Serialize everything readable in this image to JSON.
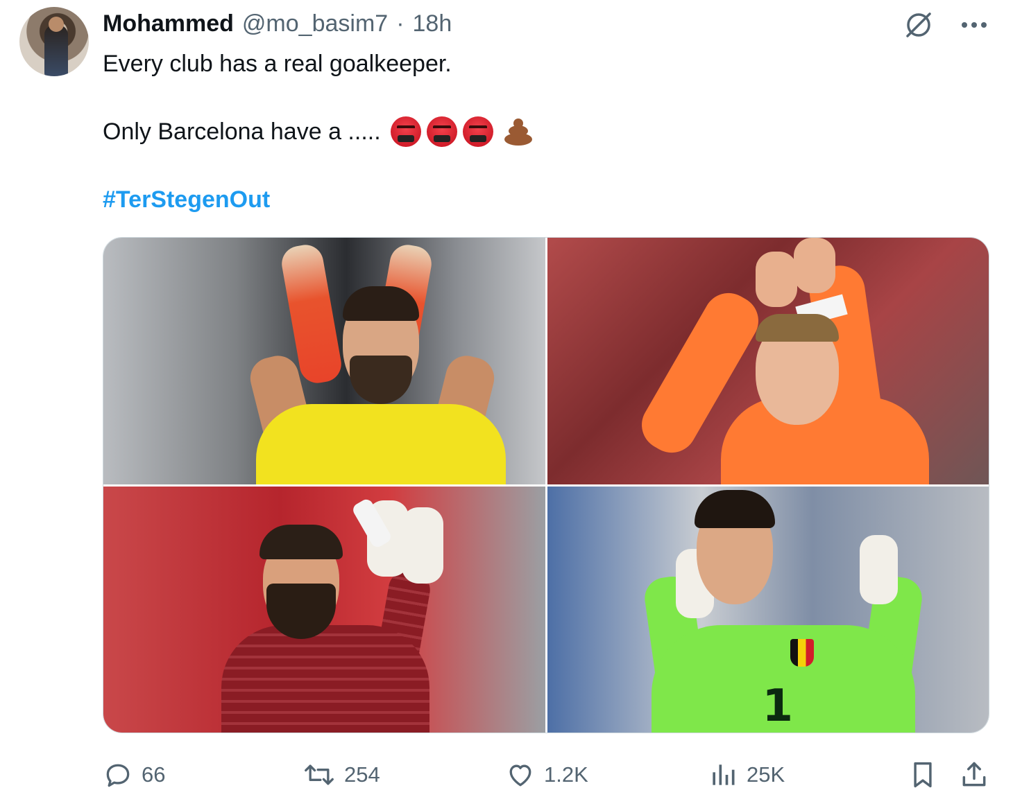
{
  "author": {
    "display_name": "Mohammed",
    "handle": "@mo_basim7",
    "separator": "·",
    "time": "18h"
  },
  "tweet": {
    "line1": "Every club has a real goalkeeper.",
    "line2": "Only Barcelona have a .....",
    "emojis": [
      "face-with-symbols-on-mouth",
      "face-with-symbols-on-mouth",
      "face-with-symbols-on-mouth",
      "pile-of-poo"
    ],
    "hashtag": "#TerStegenOut"
  },
  "media": {
    "photos": [
      {
        "name": "keeper-yellow-kit",
        "kit_color": "#f2e21f"
      },
      {
        "name": "keeper-orange-kit",
        "kit_color": "#ff7a33"
      },
      {
        "name": "keeper-red-kit",
        "kit_color": "#8a1c24"
      },
      {
        "name": "keeper-green-kit",
        "kit_color": "#7fe74a",
        "shirt_number": "1"
      }
    ]
  },
  "actions": {
    "replies": "66",
    "retweets": "254",
    "likes": "1.2K",
    "views": "25K"
  },
  "colors": {
    "text": "#0f1419",
    "secondary": "#536471",
    "link": "#1d9bf0"
  }
}
